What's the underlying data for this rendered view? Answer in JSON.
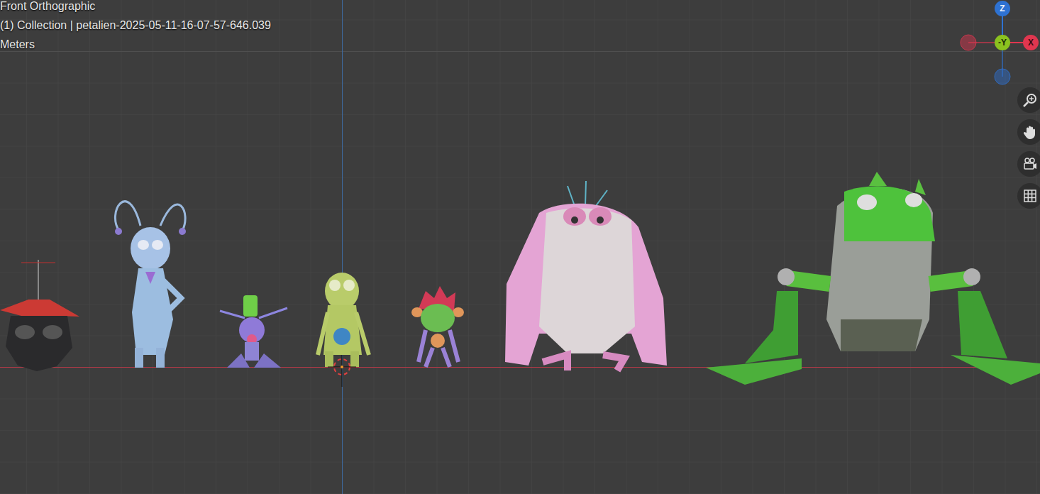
{
  "viewport": {
    "view_name": "Front Orthographic",
    "collection": "(1) Collection | petalien-2025-05-11-16-07-57-646.039",
    "units": "Meters"
  },
  "gizmo": {
    "axes": [
      {
        "label": "Z",
        "color": "#2e72d2"
      },
      {
        "label": "-Y",
        "color": "#8bc21f"
      },
      {
        "label": "X",
        "color": "#e0364f"
      }
    ]
  }
}
